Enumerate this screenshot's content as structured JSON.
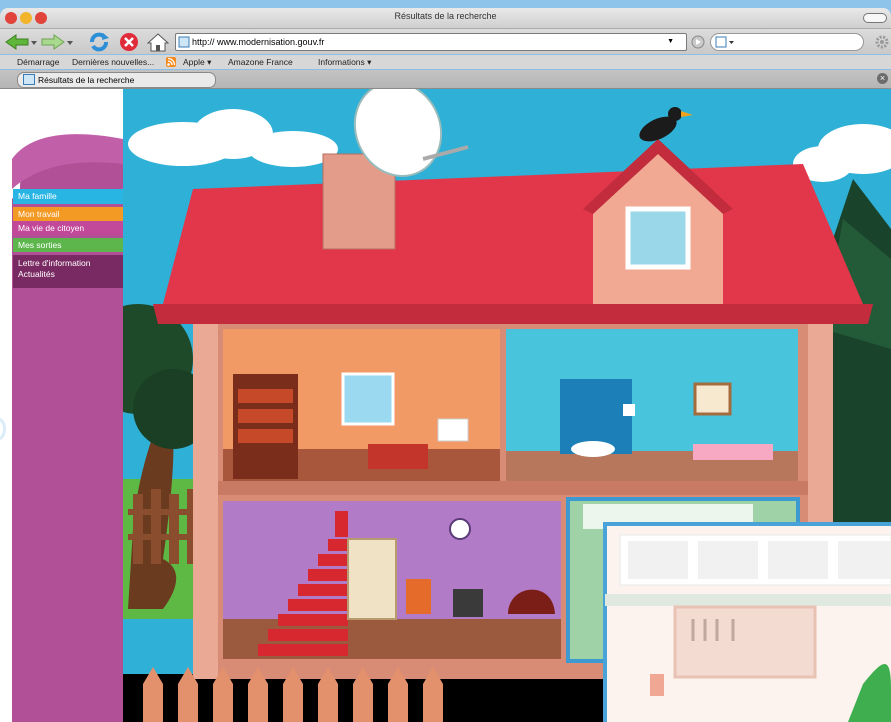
{
  "window": {
    "title": "Résultats de la recherche"
  },
  "toolbar": {
    "url": "http:// www.modernisation.gouv.fr",
    "search_placeholder": ""
  },
  "bookmarks": [
    {
      "label": "Démarrage"
    },
    {
      "label": "Dernières nouvelles..."
    },
    {
      "label": "Apple"
    },
    {
      "label": "Amazone France"
    },
    {
      "label": "Informations"
    }
  ],
  "tab": {
    "label": "Résultats de la recherche"
  },
  "sidebar": {
    "items": [
      {
        "label": "Ma famille",
        "color": "#29b5e3"
      },
      {
        "label": "Mon travail",
        "color": "#f39a25"
      },
      {
        "label": "Ma vie de citoyen",
        "color": "#c2489a"
      },
      {
        "label": "Mes sorties",
        "color": "#5cb64c"
      },
      {
        "label": "Lettre d'information",
        "color": "#7a2a63"
      },
      {
        "label": "Actualités",
        "color": "#7a2a63"
      }
    ]
  },
  "colors": {
    "roof": "#e2374a",
    "sky": "#2fb0d6",
    "sidebar_purple": "#b14f97"
  }
}
